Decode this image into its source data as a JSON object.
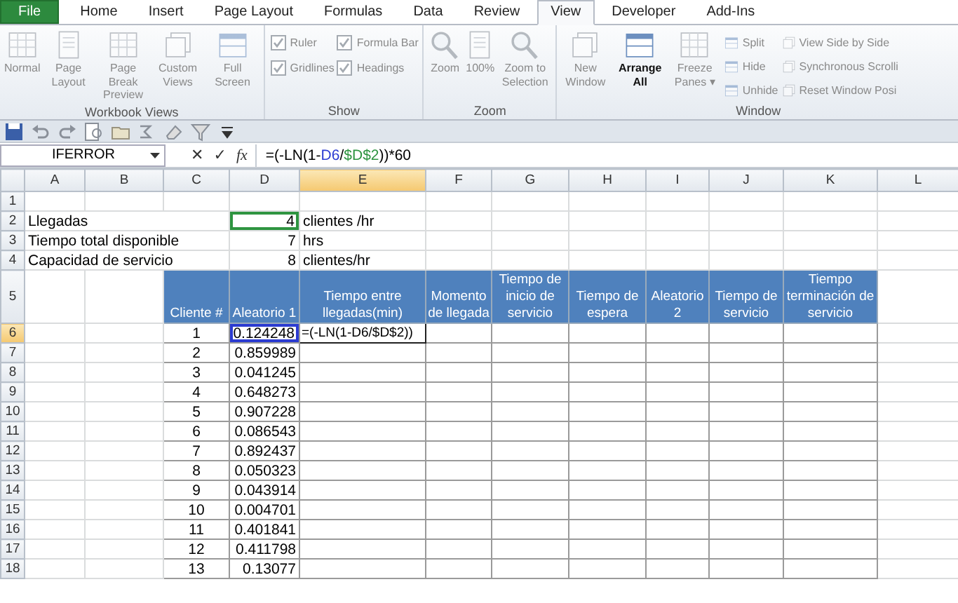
{
  "ribbon": {
    "tabs": [
      {
        "label": "File",
        "kind": "file",
        "selected": false
      },
      {
        "label": "Home",
        "kind": "tab",
        "selected": false
      },
      {
        "label": "Insert",
        "kind": "tab",
        "selected": false
      },
      {
        "label": "Page Layout",
        "kind": "tab",
        "selected": false
      },
      {
        "label": "Formulas",
        "kind": "tab",
        "selected": false
      },
      {
        "label": "Data",
        "kind": "tab",
        "selected": false
      },
      {
        "label": "Review",
        "kind": "tab",
        "selected": false
      },
      {
        "label": "View",
        "kind": "tab",
        "selected": true
      },
      {
        "label": "Developer",
        "kind": "tab",
        "selected": false
      },
      {
        "label": "Add-Ins",
        "kind": "tab",
        "selected": false
      }
    ],
    "groups": [
      {
        "label": "Workbook Views",
        "items": [
          {
            "kind": "large",
            "label": "Normal",
            "disabled": true
          },
          {
            "kind": "large",
            "label": "Page Layout",
            "disabled": true
          },
          {
            "kind": "large",
            "label": "Page Break Preview",
            "disabled": true
          },
          {
            "kind": "large",
            "label": "Custom Views",
            "disabled": true
          },
          {
            "kind": "large",
            "label": "Full Screen",
            "disabled": true
          }
        ]
      },
      {
        "label": "Show",
        "items": [
          {
            "kind": "checkbox",
            "label": "Ruler",
            "checked": true,
            "disabled": true
          },
          {
            "kind": "checkbox",
            "label": "Gridlines",
            "checked": true,
            "disabled": true
          },
          {
            "kind": "checkbox",
            "label": "Formula Bar",
            "checked": true,
            "disabled": true
          },
          {
            "kind": "checkbox",
            "label": "Headings",
            "checked": true,
            "disabled": true
          }
        ]
      },
      {
        "label": "Zoom",
        "items": [
          {
            "kind": "large",
            "label": "Zoom",
            "disabled": true
          },
          {
            "kind": "large",
            "label": "100%",
            "disabled": true
          },
          {
            "kind": "large",
            "label": "Zoom to Selection",
            "disabled": true
          }
        ]
      },
      {
        "label": "Window",
        "items": [
          {
            "kind": "large",
            "label": "New Window",
            "disabled": true
          },
          {
            "kind": "large",
            "label": "Arrange All",
            "disabled": false
          },
          {
            "kind": "large",
            "label": "Freeze Panes",
            "caret": "▾",
            "disabled": true
          },
          {
            "kind": "small",
            "label": "Split",
            "disabled": true
          },
          {
            "kind": "small",
            "label": "Hide",
            "disabled": true
          },
          {
            "kind": "small",
            "label": "Unhide",
            "disabled": true
          },
          {
            "kind": "small",
            "label": "View Side by Side",
            "disabled": true
          },
          {
            "kind": "small",
            "label": "Synchronous Scrolli",
            "disabled": true
          },
          {
            "kind": "small",
            "label": "Reset Window Posi",
            "disabled": true
          }
        ]
      }
    ]
  },
  "quick_access": [
    {
      "kind": "save"
    },
    {
      "kind": "undo"
    },
    {
      "kind": "redo"
    },
    {
      "kind": "preview"
    },
    {
      "kind": "open"
    },
    {
      "kind": "formula"
    },
    {
      "kind": "clear"
    },
    {
      "kind": "filter"
    },
    {
      "kind": "customize"
    }
  ],
  "formula_bar": {
    "name_box": "IFERROR",
    "buttons": [
      "✕",
      "✓",
      "fx"
    ],
    "formula": [
      {
        "text": "=(-LN(1-"
      },
      {
        "text": "D6",
        "color": "#2b3bd1"
      },
      {
        "text": "/"
      },
      {
        "text": "$D$2",
        "color": "#2e9440"
      },
      {
        "text": "))*60"
      }
    ]
  },
  "sheet": {
    "columns": [
      {
        "label": "A",
        "selected": false
      },
      {
        "label": "B",
        "selected": false
      },
      {
        "label": "C",
        "selected": false
      },
      {
        "label": "D",
        "selected": false
      },
      {
        "label": "E",
        "selected": true
      },
      {
        "label": "F",
        "selected": false
      },
      {
        "label": "G",
        "selected": false
      },
      {
        "label": "H",
        "selected": false
      },
      {
        "label": "I",
        "selected": false
      },
      {
        "label": "J",
        "selected": false
      },
      {
        "label": "K",
        "selected": false
      },
      {
        "label": "L",
        "selected": false
      }
    ],
    "rows": [
      {
        "number": "1",
        "selected": false,
        "kind": "plain",
        "cells": [
          null,
          null,
          null,
          null,
          null,
          null,
          null,
          null,
          null,
          null,
          null,
          null
        ]
      },
      {
        "number": "2",
        "selected": false,
        "kind": "plain",
        "cells": [
          {
            "text": "Llegadas",
            "colspan": 3
          },
          null,
          null,
          {
            "text": "4",
            "color": "#2e9440"
          },
          "clientes /hr",
          null,
          null,
          null,
          null,
          null,
          null,
          null
        ]
      },
      {
        "number": "3",
        "selected": false,
        "kind": "plain",
        "cells": [
          {
            "text": "Tiempo total disponible",
            "colspan": 3
          },
          null,
          null,
          "7",
          "hrs",
          null,
          null,
          null,
          null,
          null,
          null,
          null
        ]
      },
      {
        "number": "4",
        "selected": false,
        "kind": "plain",
        "cells": [
          {
            "text": "Capacidad de servicio",
            "colspan": 3
          },
          null,
          null,
          "8",
          "clientes/hr",
          null,
          null,
          null,
          null,
          null,
          null,
          null
        ]
      },
      {
        "number": "5",
        "selected": false,
        "kind": "header",
        "cells": [
          null,
          null,
          "Cliente #",
          "Aleatorio 1",
          "Tiempo entre llegadas(min)",
          "Momento de llegada",
          "Tiempo de inicio de servicio",
          "Tiempo de espera",
          "Aleatorio 2",
          "Tiempo de servicio",
          "Tiempo terminación de servicio",
          null
        ]
      },
      {
        "number": "6",
        "selected": true,
        "kind": "table",
        "cells": [
          null,
          null,
          "1",
          {
            "text": "0.124248",
            "color": "#2b3bd1"
          },
          {
            "text": "=(-LN(1-D6/$D$2))",
            "editing": true
          },
          null,
          null,
          null,
          null,
          null,
          null,
          null
        ]
      },
      {
        "number": "7",
        "selected": false,
        "kind": "table",
        "cells": [
          null,
          null,
          "2",
          "0.859989",
          null,
          null,
          null,
          null,
          null,
          null,
          null,
          null
        ]
      },
      {
        "number": "8",
        "selected": false,
        "kind": "table",
        "cells": [
          null,
          null,
          "3",
          "0.041245",
          null,
          null,
          null,
          null,
          null,
          null,
          null,
          null
        ]
      },
      {
        "number": "9",
        "selected": false,
        "kind": "table",
        "cells": [
          null,
          null,
          "4",
          "0.648273",
          null,
          null,
          null,
          null,
          null,
          null,
          null,
          null
        ]
      },
      {
        "number": "10",
        "selected": false,
        "kind": "table",
        "cells": [
          null,
          null,
          "5",
          "0.907228",
          null,
          null,
          null,
          null,
          null,
          null,
          null,
          null
        ]
      },
      {
        "number": "11",
        "selected": false,
        "kind": "table",
        "cells": [
          null,
          null,
          "6",
          "0.086543",
          null,
          null,
          null,
          null,
          null,
          null,
          null,
          null
        ]
      },
      {
        "number": "12",
        "selected": false,
        "kind": "table",
        "cells": [
          null,
          null,
          "7",
          "0.892437",
          null,
          null,
          null,
          null,
          null,
          null,
          null,
          null
        ]
      },
      {
        "number": "13",
        "selected": false,
        "kind": "table",
        "cells": [
          null,
          null,
          "8",
          "0.050323",
          null,
          null,
          null,
          null,
          null,
          null,
          null,
          null
        ]
      },
      {
        "number": "14",
        "selected": false,
        "kind": "table",
        "cells": [
          null,
          null,
          "9",
          "0.043914",
          null,
          null,
          null,
          null,
          null,
          null,
          null,
          null
        ]
      },
      {
        "number": "15",
        "selected": false,
        "kind": "table",
        "cells": [
          null,
          null,
          "10",
          "0.004701",
          null,
          null,
          null,
          null,
          null,
          null,
          null,
          null
        ]
      },
      {
        "number": "16",
        "selected": false,
        "kind": "table",
        "cells": [
          null,
          null,
          "11",
          "0.401841",
          null,
          null,
          null,
          null,
          null,
          null,
          null,
          null
        ]
      },
      {
        "number": "17",
        "selected": false,
        "kind": "table",
        "cells": [
          null,
          null,
          "12",
          "0.411798",
          null,
          null,
          null,
          null,
          null,
          null,
          null,
          null
        ]
      },
      {
        "number": "18",
        "selected": false,
        "kind": "table",
        "cells": [
          null,
          null,
          "13",
          "0.13077",
          null,
          null,
          null,
          null,
          null,
          null,
          null,
          null
        ]
      }
    ]
  }
}
